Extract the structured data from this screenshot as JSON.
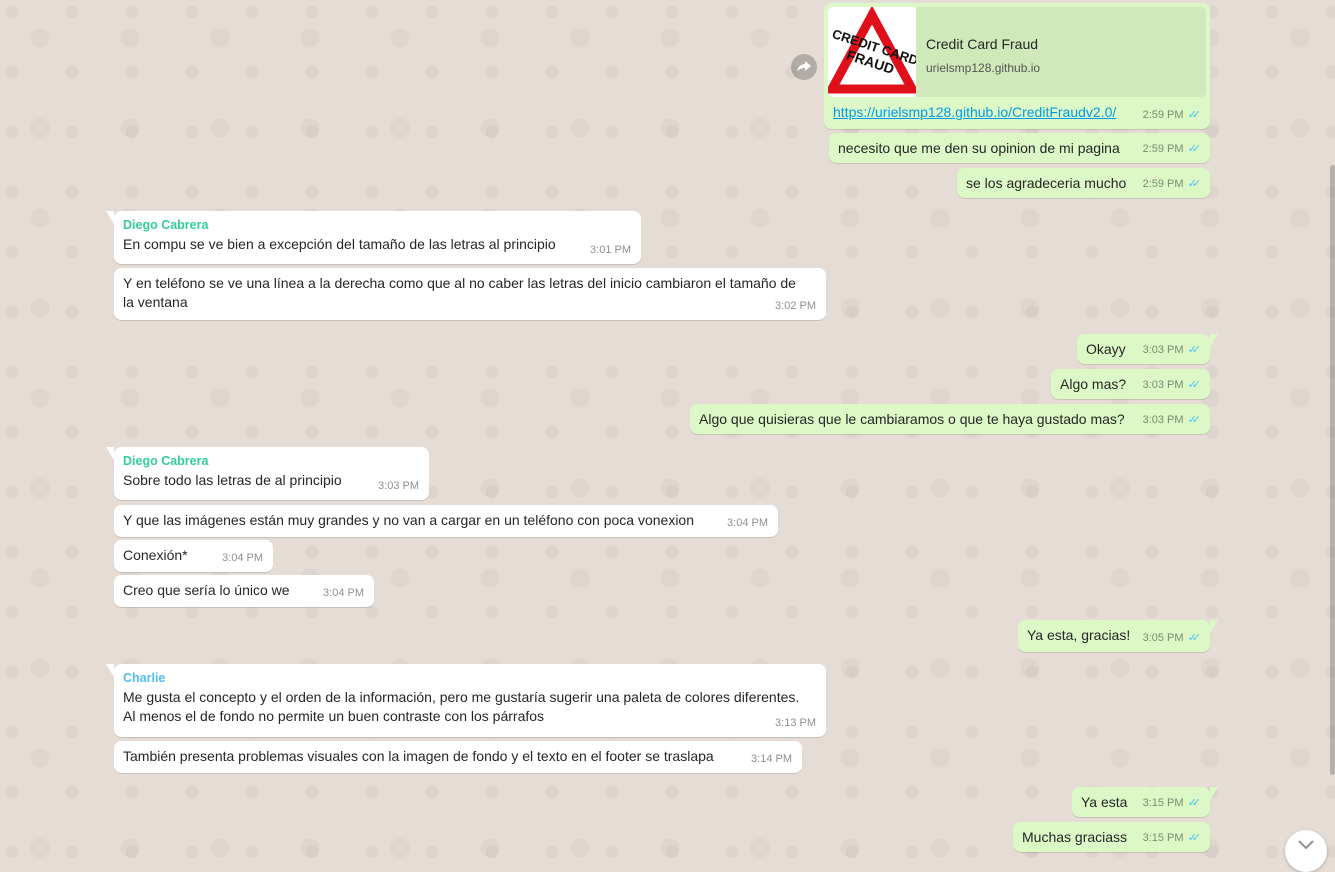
{
  "link_message": {
    "preview_title": "Credit Card Fraud",
    "preview_domain": "urielsmp128.github.io",
    "thumb_line1": "CREDIT CARD",
    "thumb_line2": "FRAUD",
    "url": "https://urielsmp128.github.io/CreditFraudv2.0/",
    "time": "2:59 PM"
  },
  "messages": [
    {
      "text": "necesito que me den su opinion de mi pagina",
      "time": "2:59 PM"
    },
    {
      "text": "se los agradeceria mucho",
      "time": "2:59 PM"
    },
    {
      "sender": "Diego Cabrera",
      "text": "En compu se ve bien a excepción del tamaño de las letras al principio",
      "time": "3:01 PM"
    },
    {
      "text": "Y en teléfono se ve una línea a la derecha como que al no caber las letras del inicio cambiaron el tamaño de la ventana",
      "time": "3:02 PM"
    },
    {
      "text": "Okayy",
      "time": "3:03 PM"
    },
    {
      "text": "Algo mas?",
      "time": "3:03 PM"
    },
    {
      "text": "Algo que quisieras que le cambiaramos o que te haya gustado mas?",
      "time": "3:03 PM"
    },
    {
      "sender": "Diego Cabrera",
      "text": "Sobre todo las letras de al principio",
      "time": "3:03 PM"
    },
    {
      "text": "Y que las imágenes están muy grandes y no van a cargar en un teléfono con poca vonexion",
      "time": "3:04 PM"
    },
    {
      "text": "Conexión*",
      "time": "3:04 PM"
    },
    {
      "text": "Creo que sería lo único we",
      "time": "3:04 PM"
    },
    {
      "text": "Ya esta, gracias!",
      "time": "3:05 PM"
    },
    {
      "sender": "Charlie",
      "text": "Me gusta el concepto y el orden de la información, pero me gustaría sugerir una paleta de colores diferentes. Al menos el de fondo no permite un buen contraste con los párrafos",
      "time": "3:13 PM"
    },
    {
      "text": "También presenta problemas visuales con la imagen de fondo y el texto en el footer se traslapa",
      "time": "3:14 PM"
    },
    {
      "text": "Ya esta",
      "time": "3:15 PM"
    },
    {
      "text": "Muchas graciass",
      "time": "3:15 PM"
    }
  ],
  "colors": {
    "outgoing_bubble": "#dcf8c6",
    "incoming_bubble": "#ffffff",
    "sender_diego": "#35cd96",
    "sender_charlie": "#53bdeb",
    "read_ticks": "#4fc3f7",
    "chat_background": "#e5ddd5"
  },
  "icons": [
    "forward-icon",
    "read-receipt-icon",
    "chevron-down-icon"
  ]
}
